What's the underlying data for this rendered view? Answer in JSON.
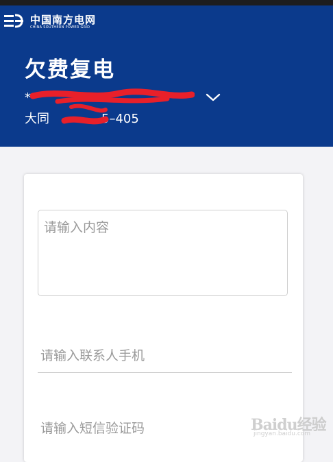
{
  "header": {
    "brand_cn": "中国南方电网",
    "brand_en": "CHINA SOUTHERN POWER GRID",
    "title": "欠费复电",
    "account_line1": "*",
    "account_line2_prefix": "大同",
    "account_line2_suffix": "5–405"
  },
  "form": {
    "content_placeholder": "请输入内容",
    "phone_placeholder": "请输入联系人手机",
    "sms_placeholder": "请输入短信验证码"
  },
  "watermark": {
    "text": "Baidu经验",
    "sub": "jingyan.baidu.com"
  },
  "colors": {
    "header_bg": "#0b3a8c",
    "page_bg": "#f3f3f6",
    "redaction": "#e8202a"
  }
}
